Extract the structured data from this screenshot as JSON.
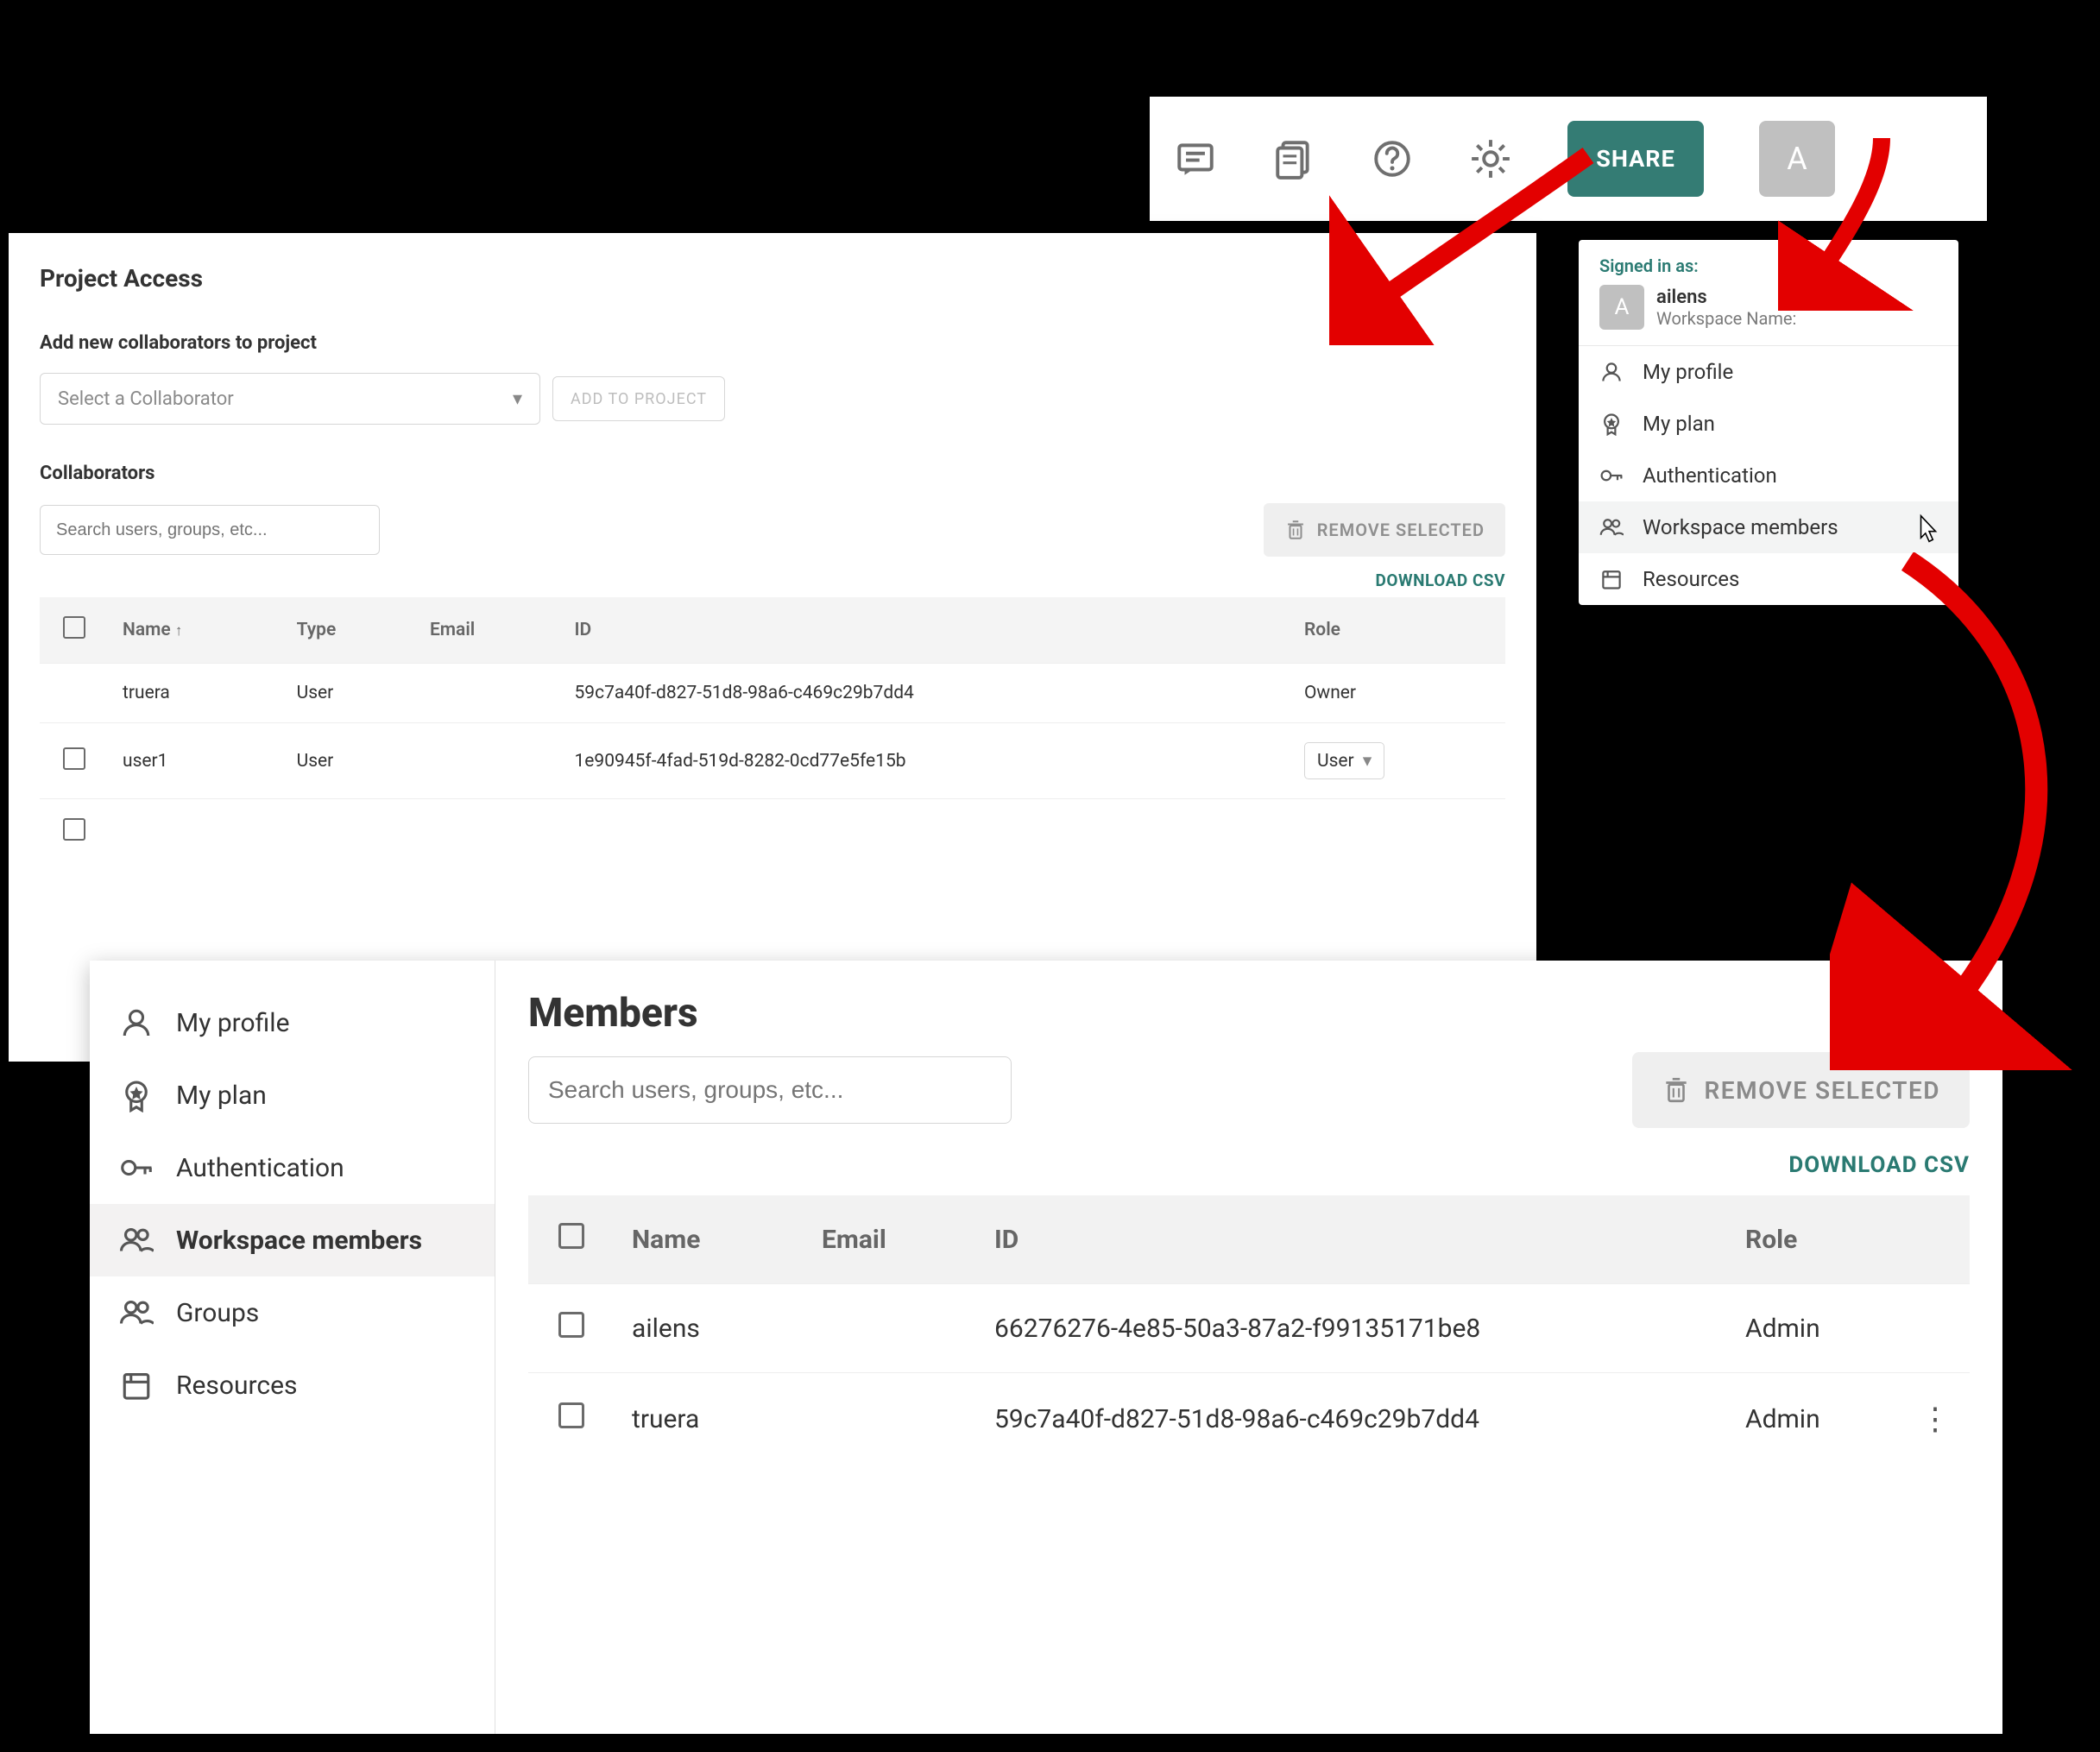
{
  "topbar": {
    "share_label": "SHARE",
    "avatar_letter": "A"
  },
  "dropdown": {
    "signed_in_label": "Signed in as:",
    "avatar_letter": "A",
    "username": "ailens",
    "workspace_label": "Workspace Name:",
    "items": [
      {
        "label": "My profile",
        "icon": "profile"
      },
      {
        "label": "My plan",
        "icon": "plan"
      },
      {
        "label": "Authentication",
        "icon": "auth"
      },
      {
        "label": "Workspace members",
        "icon": "members",
        "highlight": true
      },
      {
        "label": "Resources",
        "icon": "resources"
      }
    ]
  },
  "project": {
    "title": "Project Access",
    "add_label": "Add new collaborators to project",
    "select_placeholder": "Select a Collaborator",
    "add_button": "ADD TO PROJECT",
    "collab_label": "Collaborators",
    "search_placeholder": "Search users, groups, etc...",
    "remove_label": "REMOVE SELECTED",
    "download_label": "DOWNLOAD CSV",
    "columns": {
      "name": "Name",
      "type": "Type",
      "email": "Email",
      "id": "ID",
      "role": "Role"
    },
    "rows": [
      {
        "name": "truera",
        "type": "User",
        "email": "",
        "id": "59c7a40f-d827-51d8-98a6-c469c29b7dd4",
        "role": "Owner",
        "role_fixed": true,
        "checkbox": false
      },
      {
        "name": "user1",
        "type": "User",
        "email": "",
        "id": "1e90945f-4fad-519d-8282-0cd77e5fe15b",
        "role": "User",
        "role_fixed": false,
        "checkbox": true
      }
    ]
  },
  "members": {
    "sidebar": [
      {
        "label": "My profile",
        "icon": "profile"
      },
      {
        "label": "My plan",
        "icon": "plan"
      },
      {
        "label": "Authentication",
        "icon": "auth"
      },
      {
        "label": "Workspace members",
        "icon": "members",
        "active": true
      },
      {
        "label": "Groups",
        "icon": "members"
      },
      {
        "label": "Resources",
        "icon": "resources"
      }
    ],
    "title": "Members",
    "search_placeholder": "Search users, groups, etc...",
    "remove_label": "REMOVE SELECTED",
    "download_label": "DOWNLOAD CSV",
    "columns": {
      "name": "Name",
      "email": "Email",
      "id": "ID",
      "role": "Role"
    },
    "rows": [
      {
        "name": "ailens",
        "email": "",
        "id": "66276276-4e85-50a3-87a2-f99135171be8",
        "role": "Admin",
        "more": false
      },
      {
        "name": "truera",
        "email": "",
        "id": "59c7a40f-d827-51d8-98a6-c469c29b7dd4",
        "role": "Admin",
        "more": true
      }
    ]
  }
}
